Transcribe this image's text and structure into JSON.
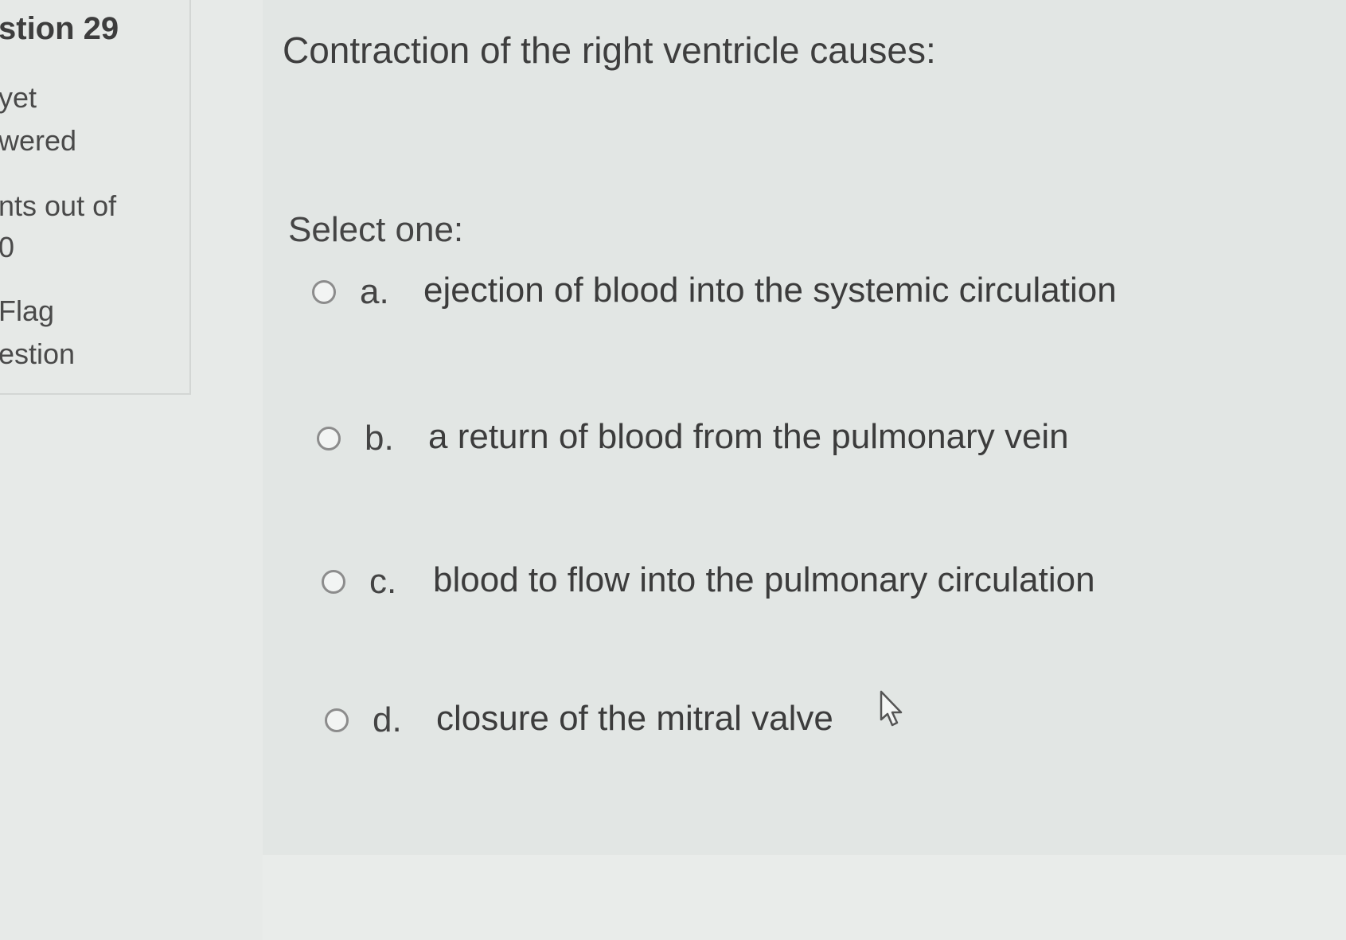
{
  "info": {
    "question_title": "stion 29",
    "status_line1": "yet",
    "status_line2": "wered",
    "marks_line1": "nts out of",
    "marks_line2": "0",
    "flag_line1": "Flag",
    "flag_line2": "estion"
  },
  "question": {
    "text": "Contraction of the right ventricle causes:",
    "prompt": "Select one:",
    "answers": [
      {
        "letter": "a.",
        "label": "ejection of blood into the systemic circulation"
      },
      {
        "letter": "b.",
        "label": "a return of blood from the pulmonary vein"
      },
      {
        "letter": "c.",
        "label": "blood to flow into the pulmonary circulation"
      },
      {
        "letter": "d.",
        "label": "closure of the mitral valve"
      }
    ]
  }
}
